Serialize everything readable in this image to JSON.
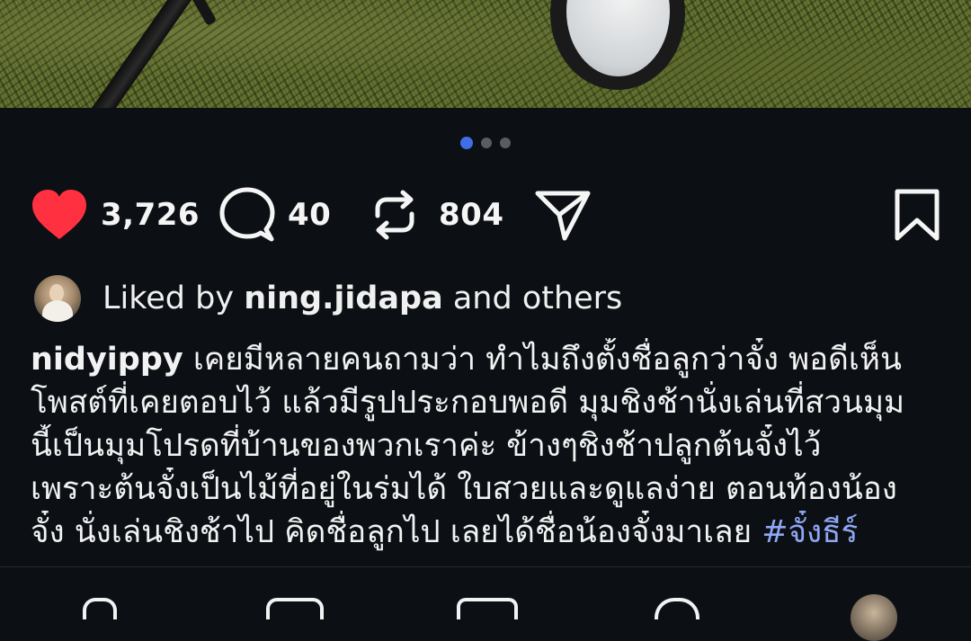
{
  "post": {
    "carousel": {
      "count": 3,
      "active_index": 0
    },
    "actions": {
      "likes": "3,726",
      "comments": "40",
      "reposts": "804"
    },
    "liked_by": {
      "prefix": "Liked by ",
      "user": "ning.jidapa",
      "suffix": " and others"
    },
    "caption": {
      "username": "nidyippy",
      "line1": " เคยมีหลายคนถามว่า ทำไมถึงตั้งชื่อลูกว่าจั๋ง พอดีเห็น",
      "line2": "โพสต์ที่เคยตอบไว้ แล้วมีรูปประกอบพอดี มุมชิงช้านั่งเล่นที่สวนมุม",
      "line3": "นี้เป็นมุมโปรดที่บ้านของพวกเราค่ะ ข้างๆชิงช้าปลูกต้นจั๋งไว้",
      "line4": "เพราะต้นจั๋งเป็นไม้ที่อยู่ในร่มได้ ใบสวยและดูแลง่าย ตอนท้องน้อง",
      "line5": "จั๋ง นั่งเล่นชิงช้าไป คิดชื่อลูกไป เลยได้ชื่อน้องจั๋งมาเลย ",
      "hashtag": "#จั๋งธีร์"
    }
  },
  "icons": {
    "like": "heart-icon",
    "comment": "comment-bubble-icon",
    "repost": "repost-icon",
    "share": "paper-plane-icon",
    "save": "bookmark-icon"
  },
  "colors": {
    "background": "#0c1014",
    "like_red": "#ff3040",
    "dot_active": "#3f6fe6",
    "hashtag": "#8fa6f5"
  }
}
